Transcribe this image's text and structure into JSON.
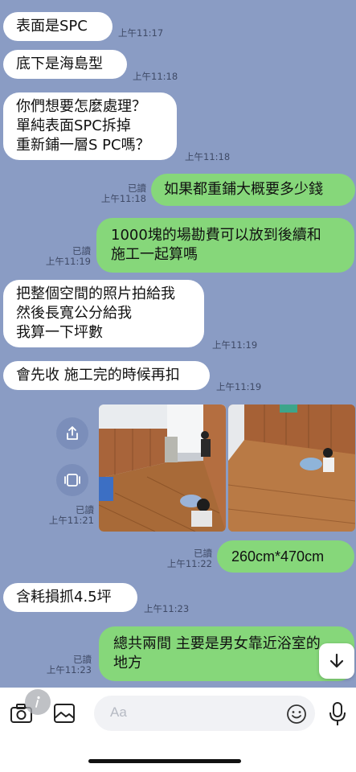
{
  "messages": [
    {
      "lines": [
        "表面是SPC"
      ],
      "time": "上午11:17"
    },
    {
      "lines": [
        "底下是海島型"
      ],
      "time": "上午11:18"
    },
    {
      "lines": [
        "你們想要怎麼處理？",
        "單純表面SPC拆掉",
        "重新鋪一層S PC嗎？"
      ],
      "time": "上午11:18"
    },
    {
      "lines": [
        "如果都重鋪大概要多少錢"
      ],
      "read": "已讀",
      "time": "上午11:18"
    },
    {
      "lines": [
        "1000塊的場勘費可以放到後續和",
        "施工一起算嗎"
      ],
      "read": "已讀",
      "time": "上午11:19"
    },
    {
      "lines": [
        "把整個空間的照片拍給我",
        "然後長寬公分給我",
        "我算一下坪數"
      ],
      "time": "上午11:19"
    },
    {
      "lines": [
        "會先收 施工完的時候再扣"
      ],
      "time": "上午11:19"
    },
    {
      "read": "已讀",
      "time": "上午11:21"
    },
    {
      "lines": [
        "260cm*470cm"
      ],
      "read": "已讀",
      "time": "上午11:22"
    },
    {
      "lines": [
        "含耗損抓4.5坪"
      ],
      "time": "上午11:23"
    },
    {
      "lines": [
        "總共兩間 主要是男女靠近浴室的",
        "地方"
      ],
      "read": "已讀",
      "time": "上午11:23"
    }
  ],
  "composer": {
    "placeholder": "Aa"
  },
  "icons": {
    "share": "share-icon",
    "album": "album-icon",
    "scroll_down": "arrow-down-icon",
    "camera": "camera-icon",
    "image": "image-icon",
    "emoji": "emoji-icon",
    "mic": "mic-icon",
    "info": "info-icon"
  },
  "colors": {
    "chat_bg": "#8a9cc4",
    "incoming": "#ffffff",
    "outgoing": "#86d77a"
  }
}
